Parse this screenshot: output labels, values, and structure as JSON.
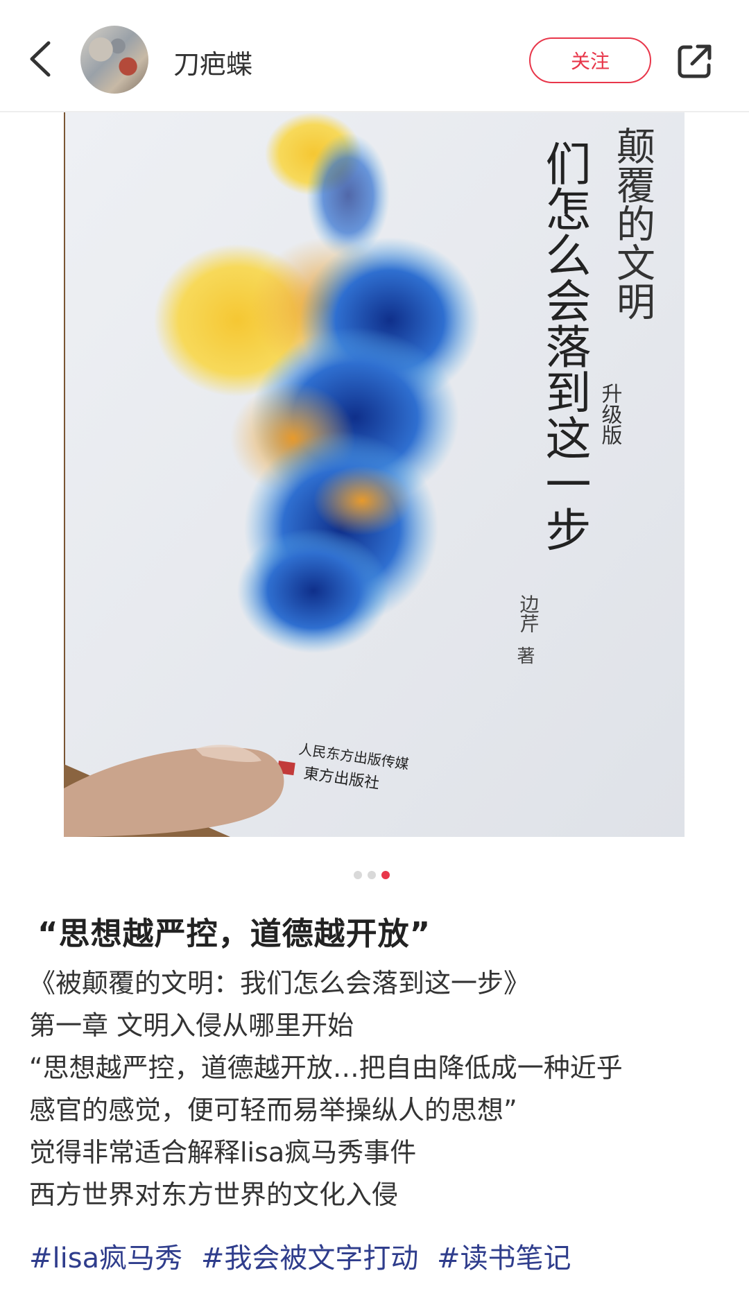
{
  "header": {
    "username": "刀疤蝶",
    "follow_label": "关注"
  },
  "photo": {
    "cover_title_col1": "们怎么会落到这一步",
    "cover_title_col2": "颠覆的文明",
    "cover_edition": "升级版",
    "cover_author": "边芹",
    "cover_author_suffix": "著",
    "publisher_line1": "人民东方出版传媒",
    "publisher_line2": "東方出版社"
  },
  "carousel": {
    "total": 3,
    "active_index": 2
  },
  "post": {
    "title": "“思想越严控，道德越开放”",
    "lines": [
      "《被颠覆的文明：我们怎么会落到这一步》",
      "第一章 文明入侵从哪里开始",
      "“思想越严控，道德越开放…把自由降低成一种近乎",
      "感官的感觉，便可轻而易举操纵人的思想”",
      "觉得非常适合解释lisa疯马秀事件",
      "西方世界对东方世界的文化入侵"
    ],
    "tags": [
      "#lisa疯马秀",
      "#我会被文字打动",
      "#读书笔记"
    ]
  },
  "colors": {
    "accent": "#e8364a",
    "tag": "#2f3d8c"
  },
  "icons": {
    "back": "chevron-left-icon",
    "share": "share-icon"
  }
}
